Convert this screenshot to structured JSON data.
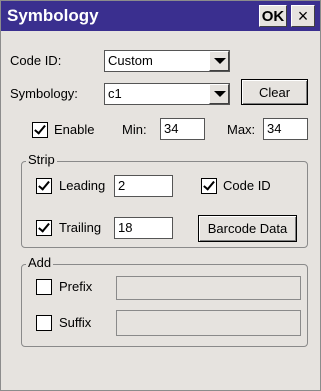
{
  "window": {
    "title": "Symbology",
    "ok_label": "OK",
    "close_label": "×"
  },
  "code_id": {
    "label": "Code ID:",
    "value": "Custom"
  },
  "symbology": {
    "label": "Symbology:",
    "value": "c1",
    "clear_label": "Clear"
  },
  "enable": {
    "label": "Enable",
    "checked": true,
    "min_label": "Min:",
    "min_value": "34",
    "max_label": "Max:",
    "max_value": "34"
  },
  "strip": {
    "legend": "Strip",
    "leading_label": "Leading",
    "leading_checked": true,
    "leading_value": "2",
    "code_id_label": "Code ID",
    "code_id_checked": true,
    "trailing_label": "Trailing",
    "trailing_checked": true,
    "trailing_value": "18",
    "barcode_data_label": "Barcode Data"
  },
  "add": {
    "legend": "Add",
    "prefix_label": "Prefix",
    "prefix_checked": false,
    "prefix_value": "",
    "suffix_label": "Suffix",
    "suffix_checked": false,
    "suffix_value": ""
  }
}
